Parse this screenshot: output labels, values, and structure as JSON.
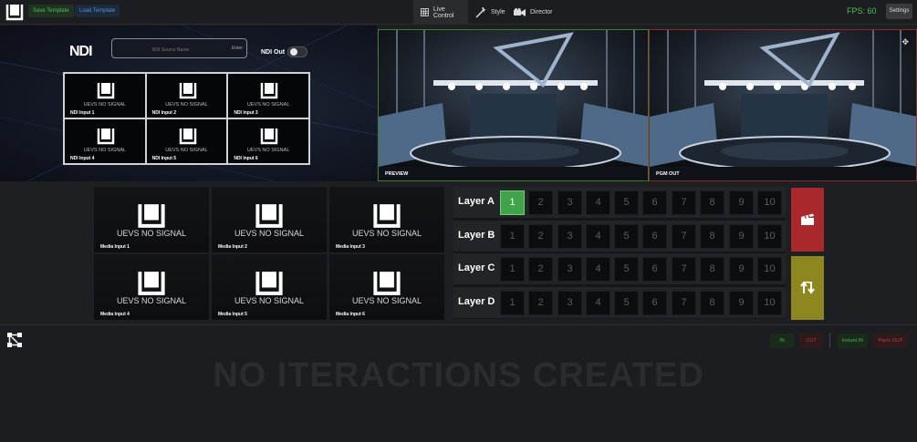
{
  "topbar": {
    "save_template": "Save Template",
    "load_template": "Load Template",
    "tabs": [
      {
        "label": "Live Control",
        "icon": "grid-icon",
        "active": true
      },
      {
        "label": "Style",
        "icon": "magic-wand-icon",
        "active": false
      },
      {
        "label": "Director",
        "icon": "camera-icon",
        "active": false
      }
    ],
    "fps": "FPS: 60",
    "settings": "Settings"
  },
  "ndi": {
    "logo": "NDI",
    "source_placeholder": "NDI Source Name",
    "enter": "Enter",
    "out_label": "NDI Out",
    "out_enabled": false,
    "no_signal": "UEVS NO SIGNAL",
    "inputs": [
      "NDI Input 1",
      "NDI Input 2",
      "NDI Input 3",
      "NDI Input 4",
      "NDI Input 5",
      "NDI Input 6"
    ]
  },
  "views": {
    "preview_label": "PREVIEW",
    "pgm_label": "PGM OUT"
  },
  "media": {
    "no_signal": "UEVS NO SIGNAL",
    "inputs": [
      "Media Input 1",
      "Media Input 2",
      "Media Input 3",
      "Media Input 4",
      "Media Input 5",
      "Media Input 6"
    ]
  },
  "layers": [
    {
      "name": "Layer A",
      "buttons": [
        "1",
        "2",
        "3",
        "4",
        "5",
        "6",
        "7",
        "8",
        "9",
        "10"
      ],
      "active": "1"
    },
    {
      "name": "Layer B",
      "buttons": [
        "1",
        "2",
        "3",
        "4",
        "5",
        "6",
        "7",
        "8",
        "9",
        "10"
      ],
      "active": ""
    },
    {
      "name": "Layer C",
      "buttons": [
        "1",
        "2",
        "3",
        "4",
        "5",
        "6",
        "7",
        "8",
        "9",
        "10"
      ],
      "active": ""
    },
    {
      "name": "Layer D",
      "buttons": [
        "1",
        "2",
        "3",
        "4",
        "5",
        "6",
        "7",
        "8",
        "9",
        "10"
      ],
      "active": ""
    }
  ],
  "actions": {
    "cut_icon": "clapperboard-icon",
    "transition_icon": "swap-arrows-icon"
  },
  "bottom": {
    "in": "IN",
    "out": "OUT",
    "instant_in": "Instant IN",
    "panic_out": "Panic OUT",
    "empty_message": "NO ITERACTIONS CREATED"
  },
  "colors": {
    "accent_green": "#3fa34a",
    "cut_red": "#a8282b",
    "transition_olive": "#8e8720",
    "fps_green": "#52c152"
  }
}
